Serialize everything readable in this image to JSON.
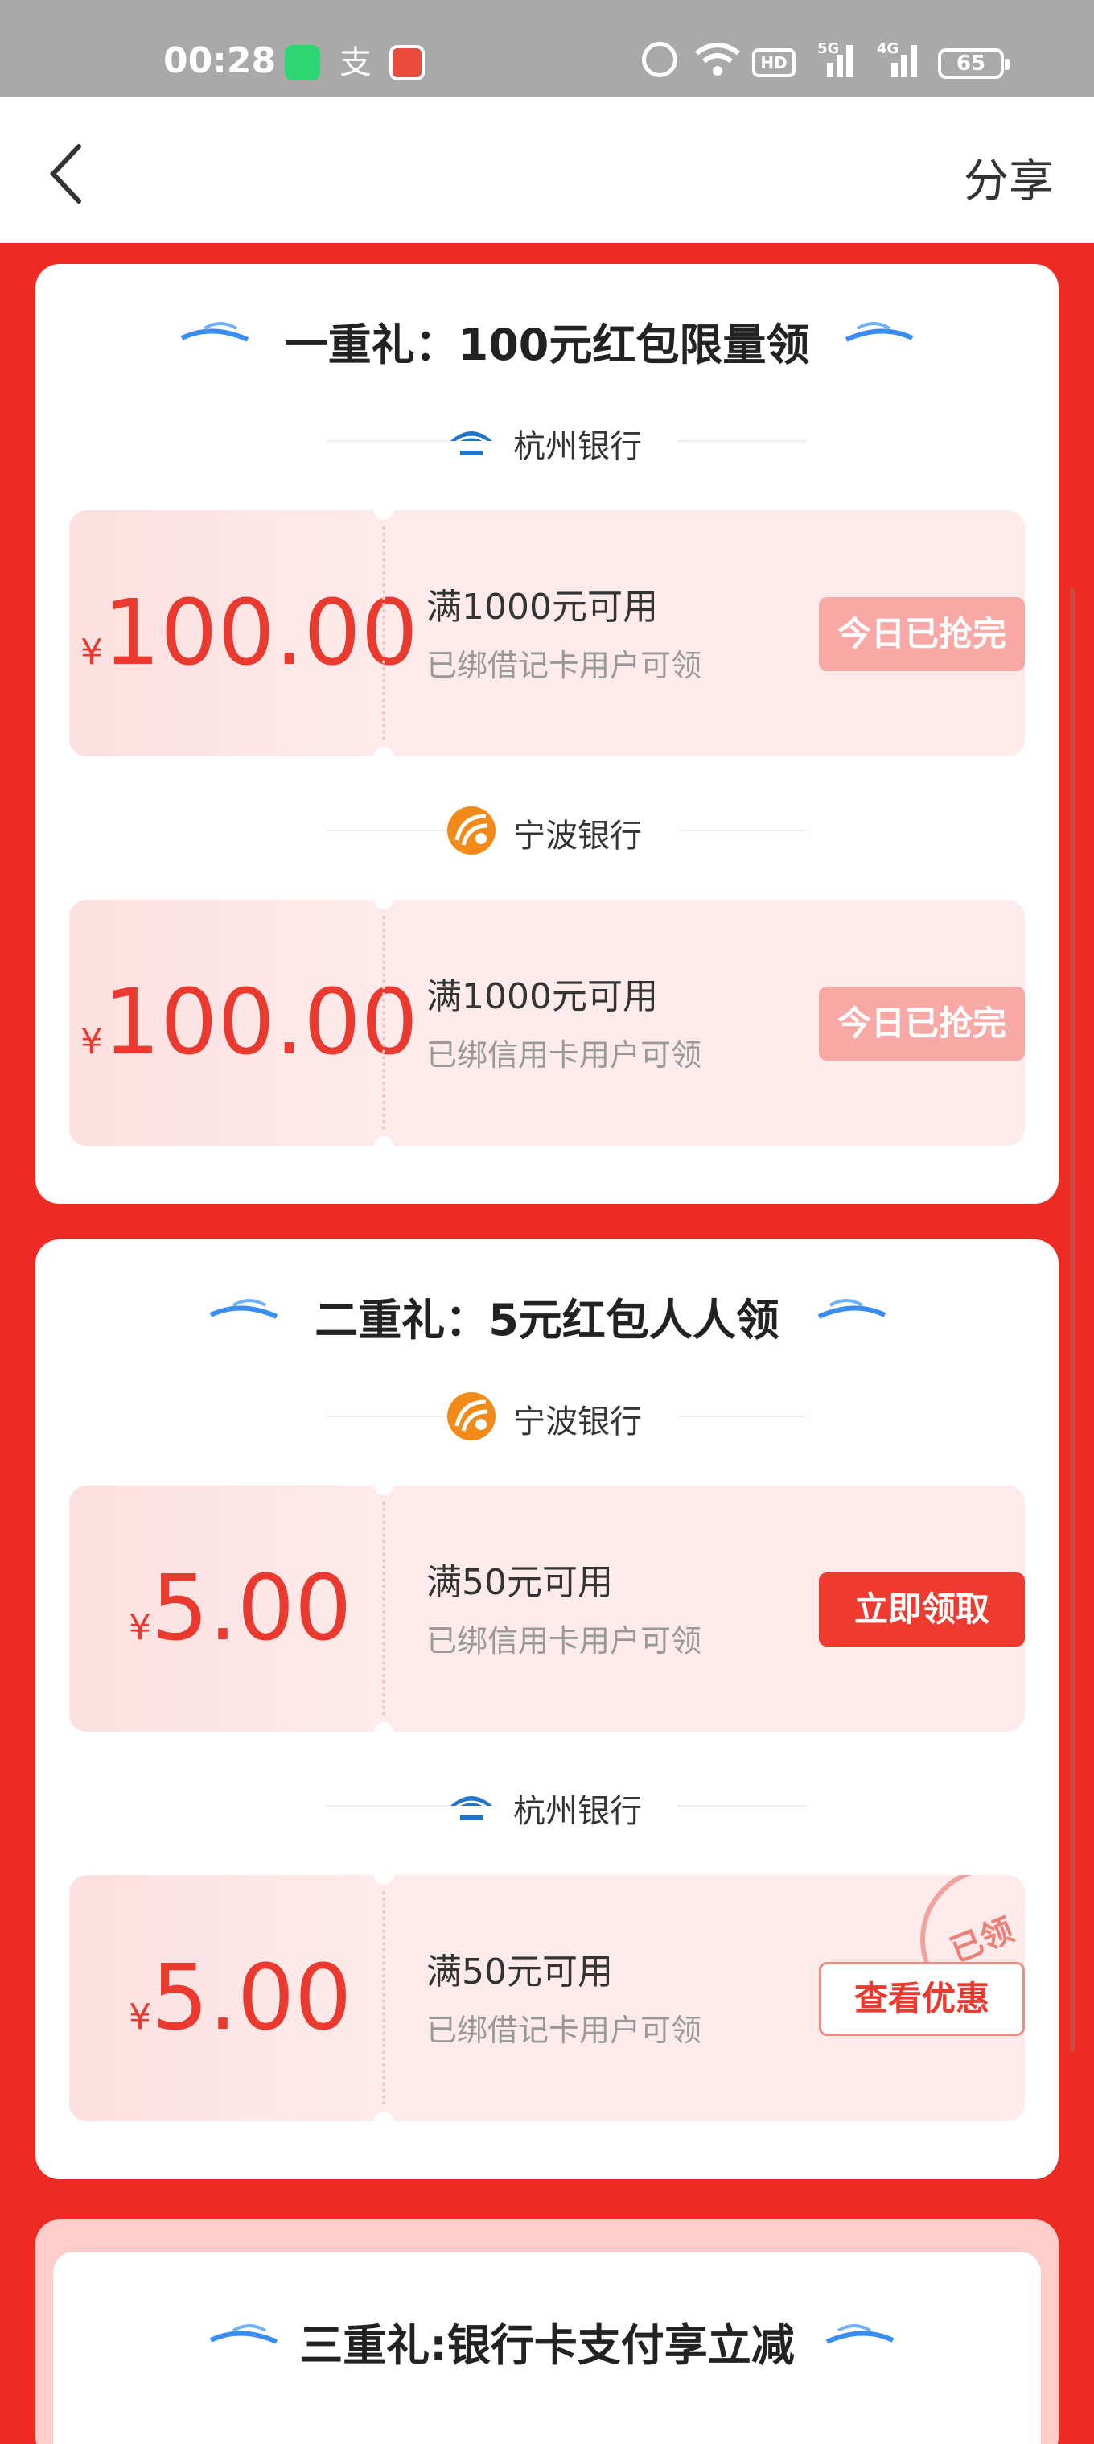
{
  "status_bar": {
    "time": "00:28",
    "battery": "65",
    "hd_label": "HD",
    "network_5g": "5G",
    "network_4g": "4G",
    "ali_glyph": "支"
  },
  "nav": {
    "share_label": "分享"
  },
  "sections": [
    {
      "title": "一重礼：100元红包限量领",
      "coupons": [
        {
          "bank": "杭州银行",
          "yen": "¥",
          "amount": "100.00",
          "condition": "满1000元可用",
          "subtext": "已绑借记卡用户可领",
          "button": "今日已抢完"
        },
        {
          "bank": "宁波银行",
          "yen": "¥",
          "amount": "100.00",
          "condition": "满1000元可用",
          "subtext": "已绑信用卡用户可领",
          "button": "今日已抢完"
        }
      ]
    },
    {
      "title": "二重礼：5元红包人人领",
      "coupons": [
        {
          "bank": "宁波银行",
          "yen": "¥",
          "amount": "5.00",
          "condition": "满50元可用",
          "subtext": "已绑信用卡用户可领",
          "button": "立即领取"
        },
        {
          "bank": "杭州银行",
          "yen": "¥",
          "amount": "5.00",
          "condition": "满50元可用",
          "subtext": "已绑借记卡用户可领",
          "button": "查看优惠",
          "stamp": "已领取"
        }
      ]
    },
    {
      "title": "三重礼:银行卡支付享立减"
    }
  ],
  "colors": {
    "page_bg": "#ee2a24",
    "accent_red": "#ea3a30",
    "sold_out_button": "#f8a9a6",
    "claim_button": "#ef3a2f"
  }
}
